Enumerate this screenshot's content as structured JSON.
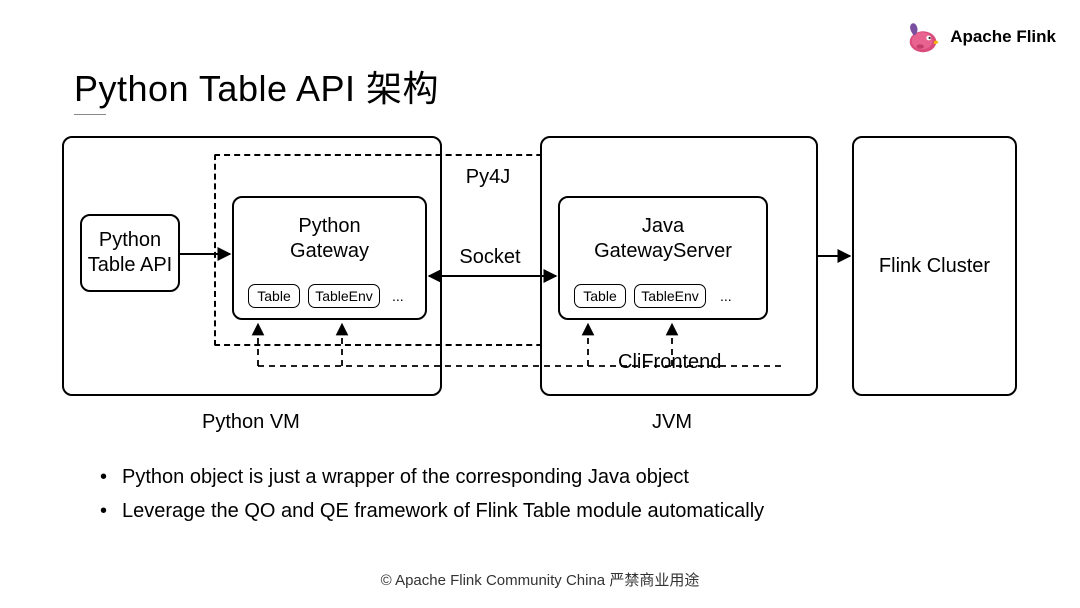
{
  "header": {
    "brand": "Apache Flink"
  },
  "title": "Python Table API 架构",
  "diagram": {
    "py4j_label": "Py4J",
    "clifrontend_label": "CliFrontend",
    "socket_label": "Socket",
    "python_vm": {
      "label": "Python VM",
      "api_box": {
        "line1": "Python",
        "line2": "Table API"
      },
      "gateway_box": {
        "line1": "Python",
        "line2": "Gateway",
        "chips": {
          "table": "Table",
          "tableenv": "TableEnv",
          "more": "..."
        }
      }
    },
    "jvm": {
      "label": "JVM",
      "gatewayserver_box": {
        "line1": "Java",
        "line2": "GatewayServer",
        "chips": {
          "table": "Table",
          "tableenv": "TableEnv",
          "more": "..."
        }
      }
    },
    "cluster_box": "Flink Cluster"
  },
  "bullets": [
    "Python object is just a wrapper of the corresponding Java object",
    "Leverage the QO and QE framework of Flink Table module automatically"
  ],
  "footer": "© Apache Flink Community China  严禁商业用途"
}
